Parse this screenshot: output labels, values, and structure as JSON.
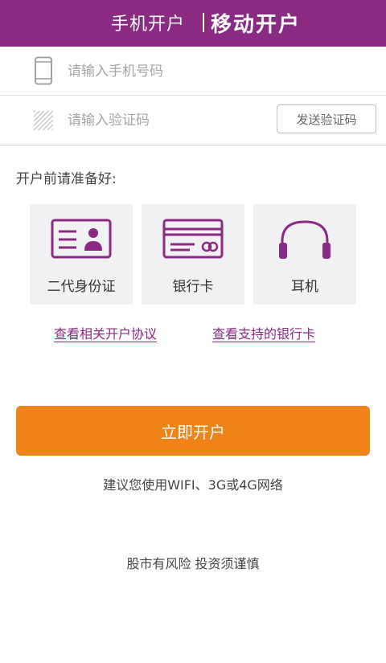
{
  "header": {
    "title_left": "手机开户",
    "title_right": "移动开户"
  },
  "form": {
    "phone_placeholder": "请输入手机号码",
    "code_placeholder": "请输入验证码",
    "send_code_label": "发送验证码"
  },
  "prep": {
    "heading": "开户前请准备好:",
    "items": [
      {
        "label": "二代身份证",
        "icon": "id-card-icon"
      },
      {
        "label": "银行卡",
        "icon": "bank-card-icon"
      },
      {
        "label": "耳机",
        "icon": "headphones-icon"
      }
    ]
  },
  "links": {
    "agreement": "查看相关开户协议",
    "banks": "查看支持的银行卡"
  },
  "actions": {
    "open_account": "立即开户"
  },
  "notes": {
    "network": "建议您使用WIFI、3G或4G网络",
    "risk": "股市有风险 投资须谨慎"
  },
  "colors": {
    "brand": "#8a2a83",
    "button": "#f08318"
  }
}
